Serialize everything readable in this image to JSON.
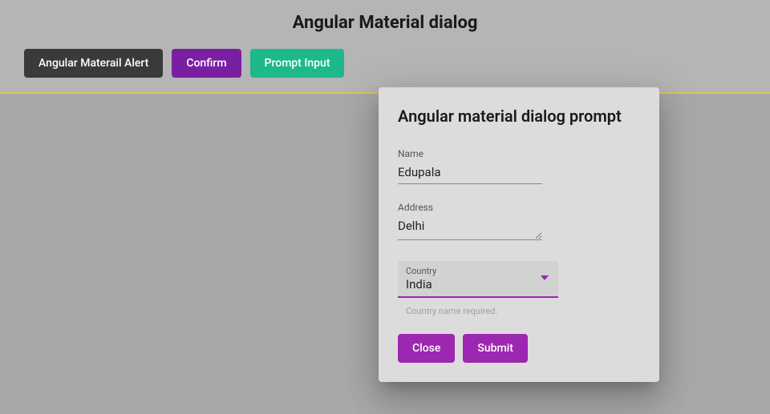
{
  "header": {
    "title": "Angular Material dialog"
  },
  "buttons": {
    "alert": "Angular Materail Alert",
    "confirm": "Confirm",
    "prompt": "Prompt Input"
  },
  "dialog": {
    "title": "Angular material dialog prompt",
    "fields": {
      "name": {
        "label": "Name",
        "value": "Edupala"
      },
      "address": {
        "label": "Address",
        "value": "Delhi"
      },
      "country": {
        "label": "Country",
        "value": "India",
        "hint": "Country name required."
      }
    },
    "actions": {
      "close": "Close",
      "submit": "Submit"
    }
  }
}
